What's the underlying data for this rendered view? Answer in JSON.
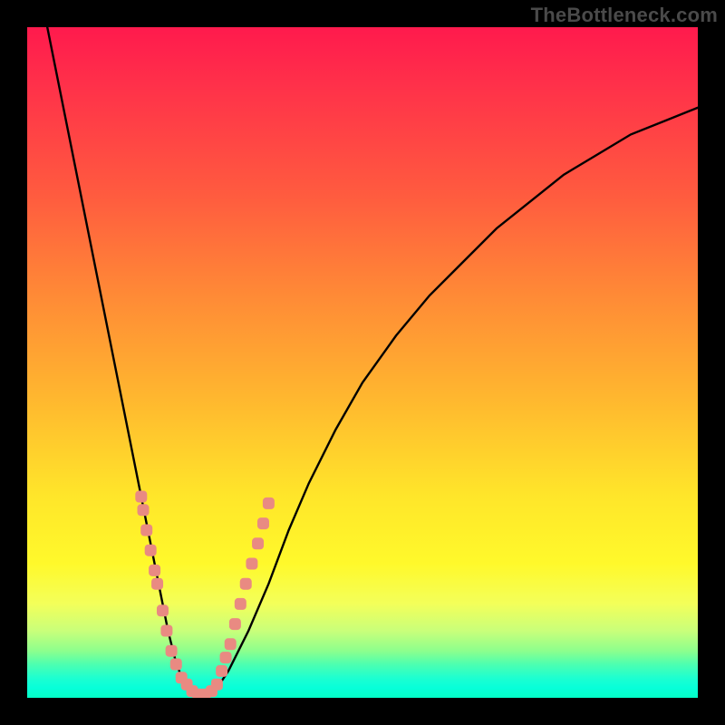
{
  "watermark": "TheBottleneck.com",
  "chart_data": {
    "type": "line",
    "title": "",
    "xlabel": "",
    "ylabel": "",
    "xlim": [
      0,
      100
    ],
    "ylim": [
      0,
      100
    ],
    "grid": false,
    "legend": false,
    "series": [
      {
        "name": "bottleneck-curve",
        "color": "#000000",
        "x": [
          3,
          4,
          5,
          6,
          7,
          8,
          9,
          10,
          11,
          12,
          13,
          14,
          15,
          16,
          17,
          18,
          19,
          20,
          21,
          22,
          23,
          24,
          25,
          26,
          27,
          28,
          30,
          33,
          36,
          39,
          42,
          46,
          50,
          55,
          60,
          65,
          70,
          75,
          80,
          85,
          90,
          95,
          100
        ],
        "y": [
          100,
          95,
          90,
          85,
          80,
          75,
          70,
          65,
          60,
          55,
          50,
          45,
          40,
          35,
          30,
          25,
          20,
          15,
          10,
          6,
          3,
          1,
          0,
          0,
          0,
          1,
          4,
          10,
          17,
          25,
          32,
          40,
          47,
          54,
          60,
          65,
          70,
          74,
          78,
          81,
          84,
          86,
          88
        ]
      }
    ],
    "markers": [
      {
        "name": "highlight-dots-left",
        "color": "#e98a82",
        "shape": "rounded-square",
        "points": [
          {
            "x": 17.0,
            "y": 30
          },
          {
            "x": 17.3,
            "y": 28
          },
          {
            "x": 17.8,
            "y": 25
          },
          {
            "x": 18.4,
            "y": 22
          },
          {
            "x": 19.0,
            "y": 19
          },
          {
            "x": 19.4,
            "y": 17
          },
          {
            "x": 20.2,
            "y": 13
          },
          {
            "x": 20.8,
            "y": 10
          },
          {
            "x": 21.5,
            "y": 7
          },
          {
            "x": 22.2,
            "y": 5
          },
          {
            "x": 23.0,
            "y": 3
          },
          {
            "x": 23.8,
            "y": 2
          },
          {
            "x": 24.6,
            "y": 1
          },
          {
            "x": 25.5,
            "y": 0.5
          },
          {
            "x": 26.5,
            "y": 0.5
          }
        ]
      },
      {
        "name": "highlight-dots-right",
        "color": "#e98a82",
        "shape": "rounded-square",
        "points": [
          {
            "x": 27.5,
            "y": 1
          },
          {
            "x": 28.3,
            "y": 2
          },
          {
            "x": 29.0,
            "y": 4
          },
          {
            "x": 29.6,
            "y": 6
          },
          {
            "x": 30.3,
            "y": 8
          },
          {
            "x": 31.0,
            "y": 11
          },
          {
            "x": 31.8,
            "y": 14
          },
          {
            "x": 32.6,
            "y": 17
          },
          {
            "x": 33.5,
            "y": 20
          },
          {
            "x": 34.4,
            "y": 23
          },
          {
            "x": 35.2,
            "y": 26
          },
          {
            "x": 36.0,
            "y": 29
          }
        ]
      }
    ]
  }
}
